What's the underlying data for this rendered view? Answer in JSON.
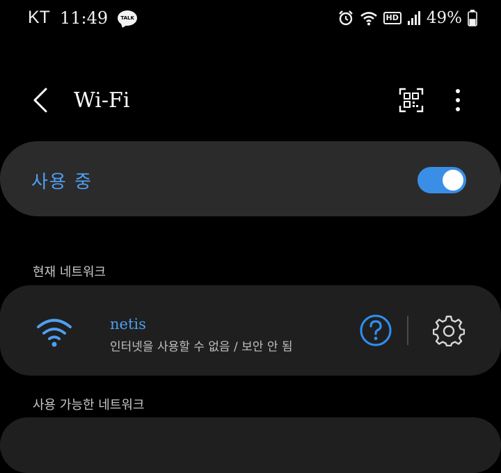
{
  "status_bar": {
    "carrier": "KT",
    "time": "11:49",
    "talk_badge": "TALK",
    "hd_badge": "HD",
    "battery_percent": "49%",
    "battery_level": 0.49,
    "icons": [
      "kakaotalk-icon",
      "alarm-icon",
      "wifi-signal-icon",
      "hd-voice-icon",
      "cell-signal-icon",
      "battery-icon"
    ]
  },
  "app_bar": {
    "title": "Wi-Fi",
    "icons": [
      "back-arrow-icon",
      "qr-scan-icon",
      "more-options-icon"
    ]
  },
  "wifi_toggle": {
    "label": "사용 중",
    "enabled": true,
    "accent_color": "#3a8ee6"
  },
  "current_network": {
    "section_title": "현재 네트워크",
    "name": "netis",
    "status": "인터넷을 사용할 수 없음 / 보안 안 됨",
    "icons": [
      "wifi-icon",
      "help-icon",
      "settings-gear-icon"
    ]
  },
  "available_networks": {
    "section_title": "사용 가능한 네트워크"
  }
}
